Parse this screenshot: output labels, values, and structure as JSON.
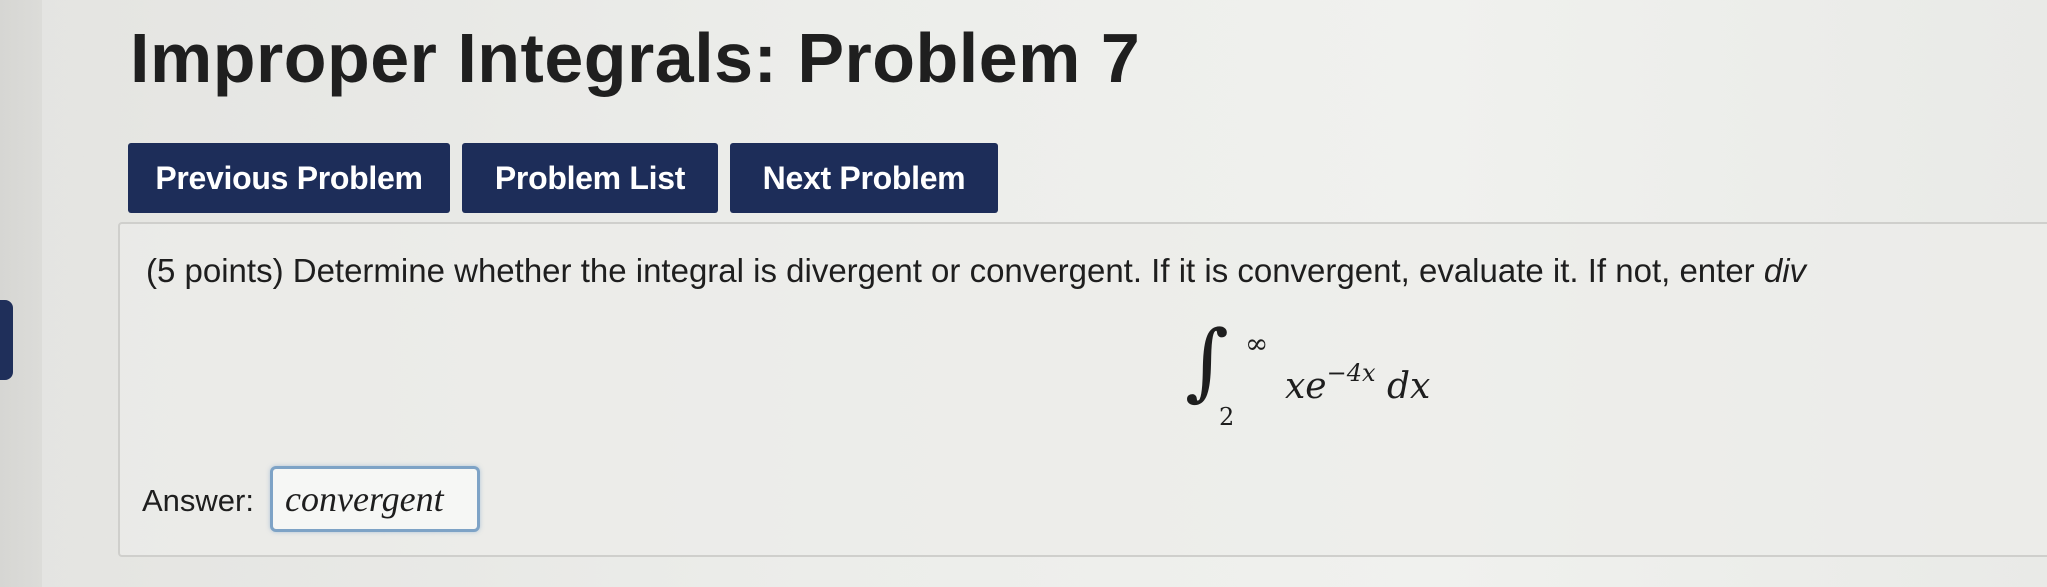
{
  "page": {
    "title": "Improper Integrals: Problem 7"
  },
  "nav": {
    "previous_label": "Previous Problem",
    "list_label": "Problem List",
    "next_label": "Next Problem"
  },
  "problem": {
    "points": "(5 points)",
    "statement": " Determine whether the integral is divergent or convergent. If it is convergent, evaluate it. If not, enter ",
    "statement_div": "div",
    "integral": {
      "upper_limit": "∞",
      "lower_limit": "2",
      "integrand_base": "xe",
      "integrand_exponent": "−4x",
      "differential": "dx"
    }
  },
  "answer": {
    "label": "Answer:",
    "value": "convergent"
  },
  "colors": {
    "button_bg": "#1d2d59",
    "input_border": "#7ea3c6"
  }
}
